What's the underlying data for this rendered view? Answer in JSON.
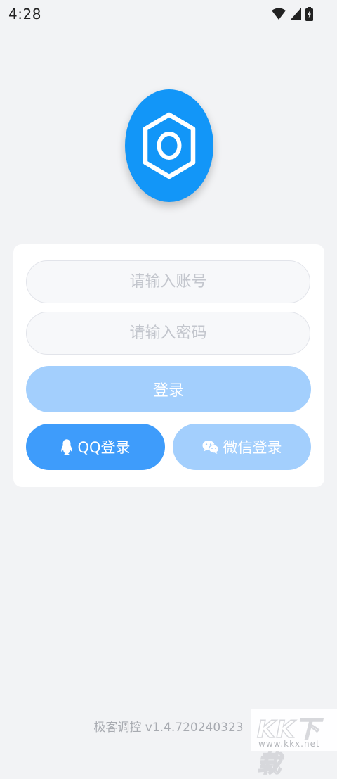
{
  "status_bar": {
    "time": "4:28",
    "icons": [
      "wifi-icon",
      "cellular-signal-icon",
      "battery-charging-icon"
    ]
  },
  "logo": {
    "icon": "hexagon-nut-icon",
    "color": "#1296f8"
  },
  "form": {
    "account_placeholder": "请输入账号",
    "account_value": "",
    "password_placeholder": "请输入密码",
    "password_value": "",
    "login_label": "登录",
    "qq_login_label": "QQ登录",
    "qq_icon": "qq-penguin-icon",
    "wechat_login_label": "微信登录",
    "wechat_icon": "wechat-icon"
  },
  "colors": {
    "background": "#f2f3f5",
    "primary": "#3e9cfb",
    "primary_light": "#a3cffd"
  },
  "footer": {
    "version": "极客调控 v1.4.720240323"
  },
  "watermark": {
    "brand": "KK下载",
    "url": "www.kkx.net"
  }
}
